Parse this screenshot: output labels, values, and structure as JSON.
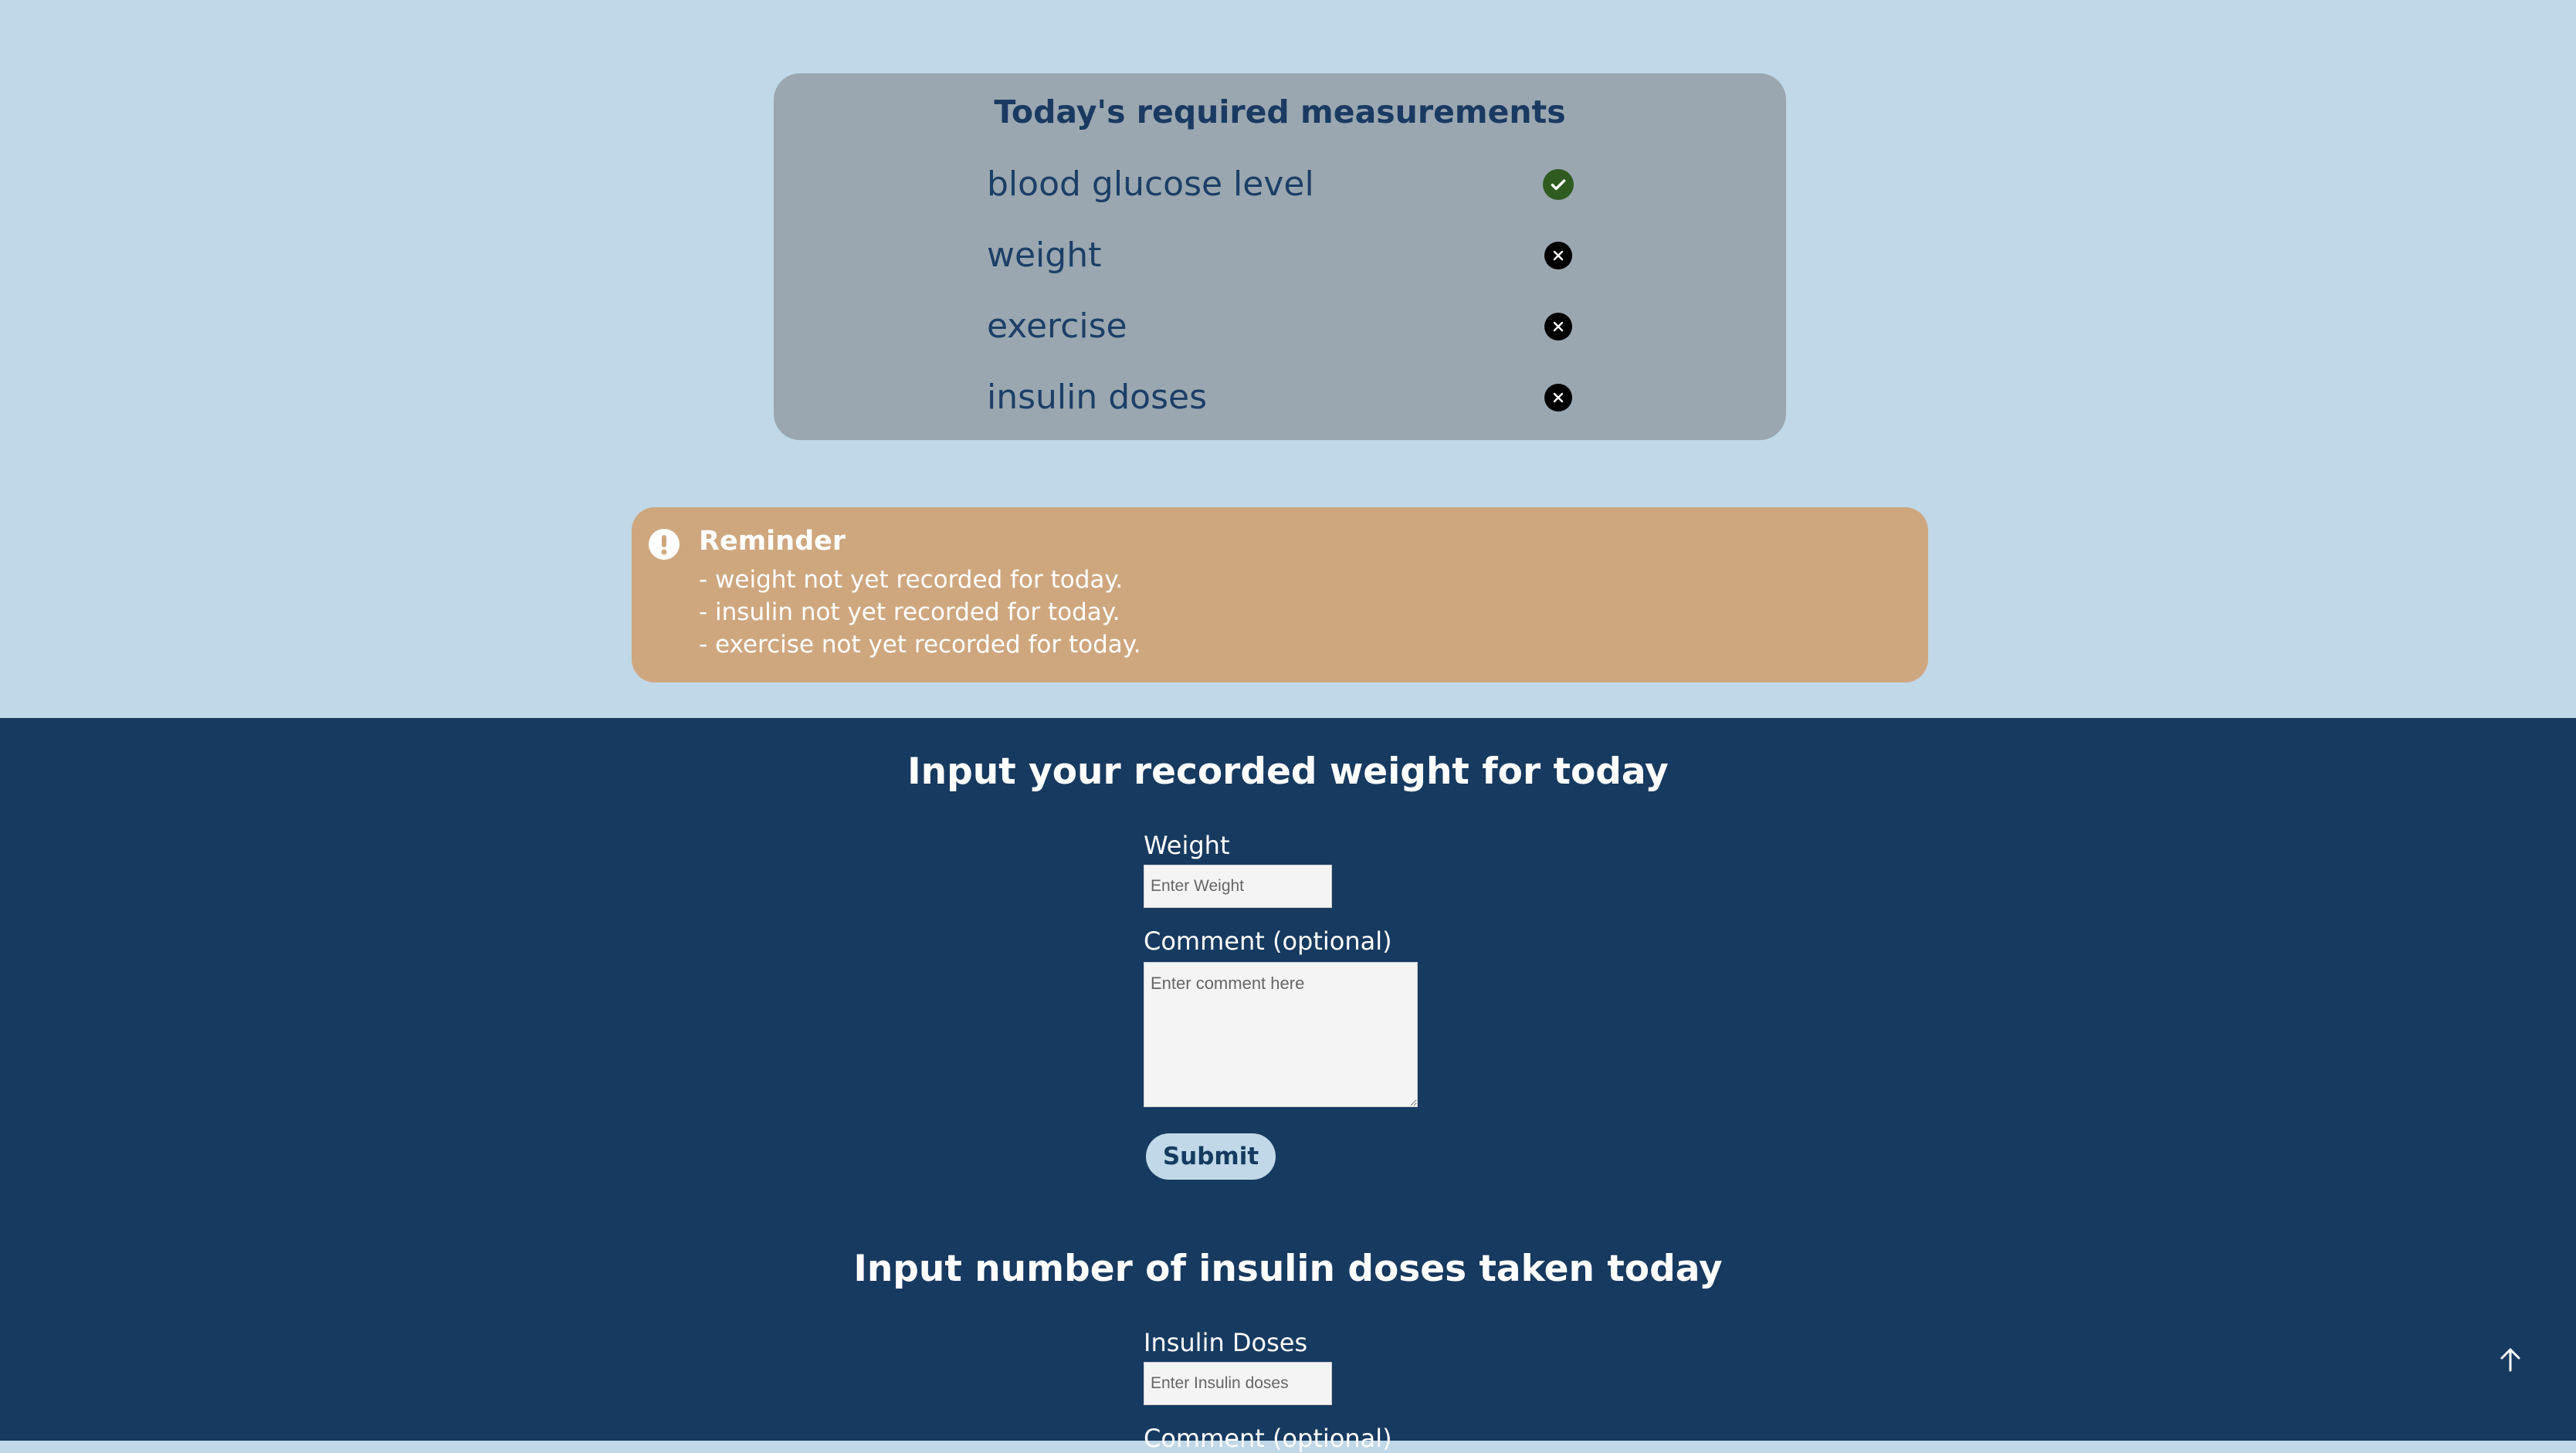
{
  "measurements": {
    "title": "Today's required measurements",
    "items": [
      {
        "label": "blood glucose level",
        "status_icon": "check-circle-icon",
        "done": true
      },
      {
        "label": "weight",
        "status_icon": "x-circle-icon",
        "done": false
      },
      {
        "label": "exercise",
        "status_icon": "x-circle-icon",
        "done": false
      },
      {
        "label": "insulin doses",
        "status_icon": "x-circle-icon",
        "done": false
      }
    ]
  },
  "reminder": {
    "icon": "exclamation-circle-icon",
    "title": "Reminder",
    "lines": [
      "- weight not yet recorded for today.",
      "- insulin not yet recorded for today.",
      "- exercise not yet recorded for today."
    ]
  },
  "weight_form": {
    "heading": "Input your recorded weight for today",
    "field_label": "Weight",
    "field_placeholder": "Enter Weight",
    "comment_label": "Comment (optional)",
    "comment_placeholder": "Enter comment here",
    "submit_label": "Submit"
  },
  "insulin_form": {
    "heading": "Input number of insulin doses taken today",
    "field_label": "Insulin Doses",
    "field_placeholder": "Enter Insulin doses",
    "comment_label": "Comment (optional)"
  },
  "scroll_top": {
    "icon": "arrow-up-icon"
  },
  "colors": {
    "top_background": "#c0d8e7",
    "bottom_background": "#173a60",
    "card_background": "#9aa7b0",
    "reminder_background": "#cfa77f",
    "check_green": "#2f5b21"
  }
}
